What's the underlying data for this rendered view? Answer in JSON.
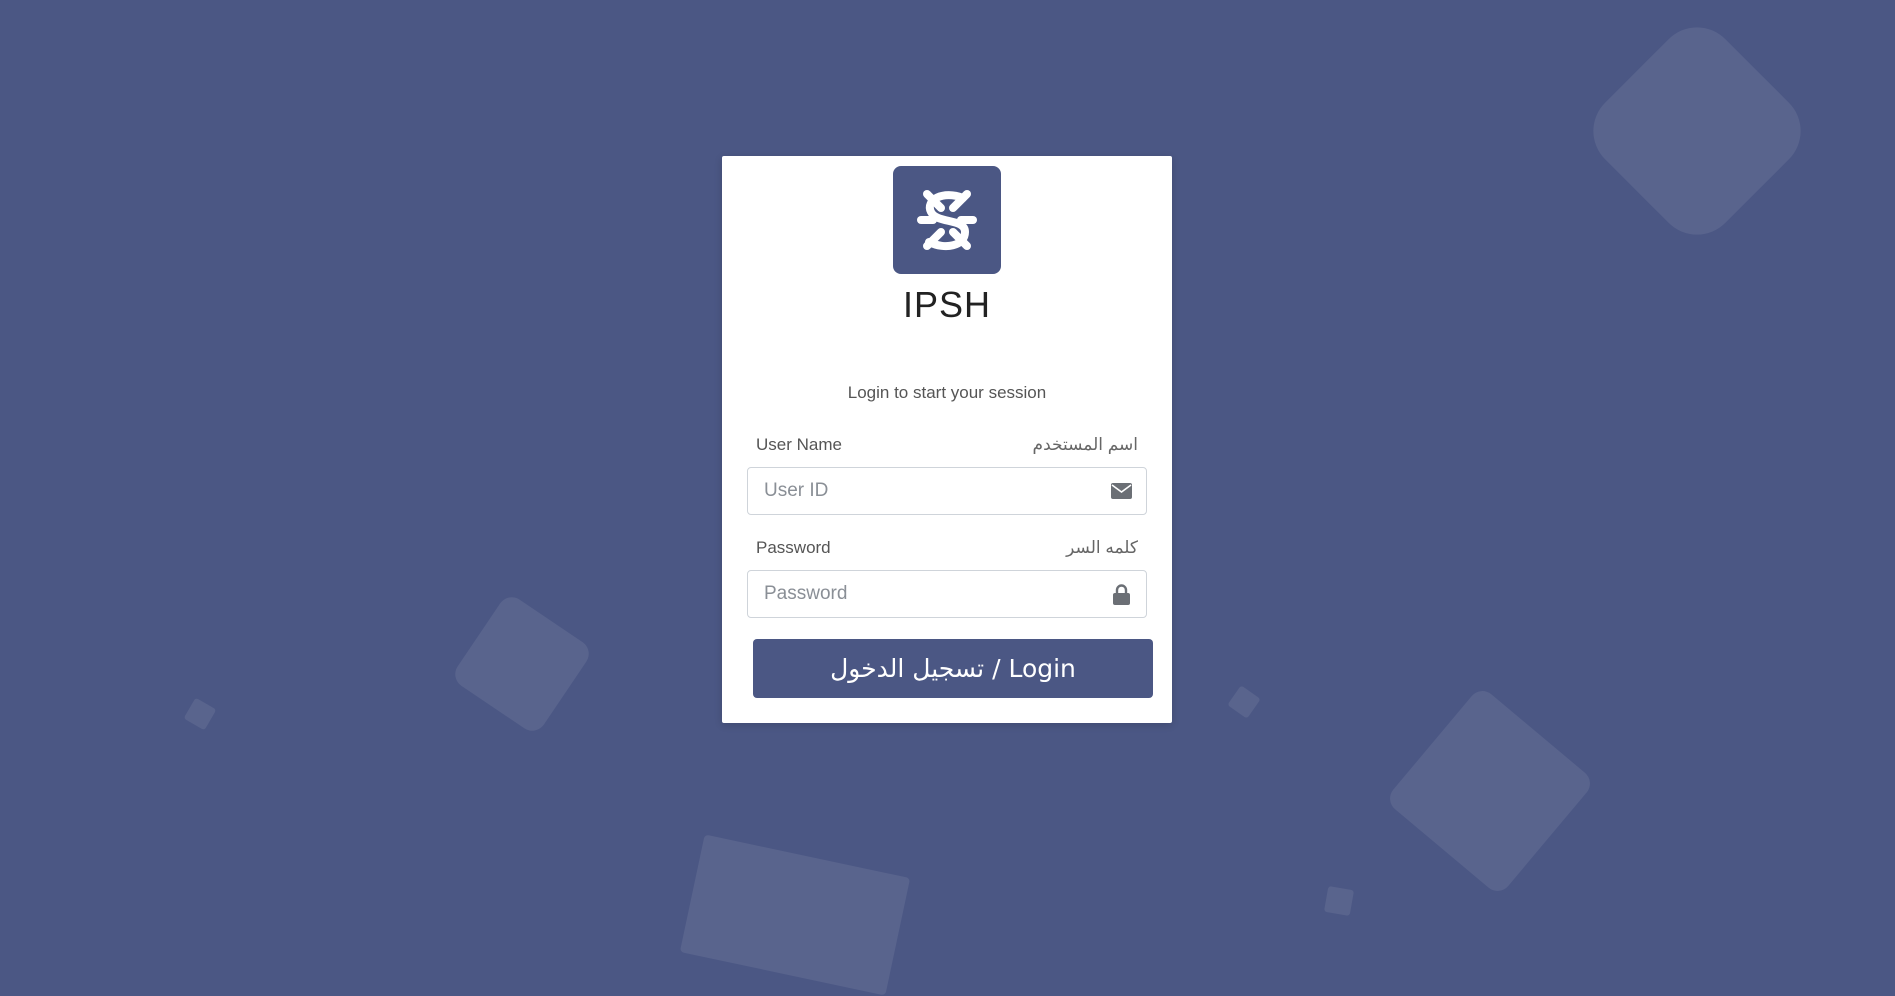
{
  "brand": {
    "name": "IPSH",
    "logo_icon": "ipsh-knot-logo-icon",
    "color": "#4b5784"
  },
  "login": {
    "subtitle": "Login to start your session",
    "username": {
      "label_en": "User Name",
      "label_ar": "اسم المستخدم",
      "placeholder": "User ID",
      "value": "",
      "icon": "envelope-icon"
    },
    "password": {
      "label_en": "Password",
      "label_ar": "كلمه السر",
      "placeholder": "Password",
      "value": "",
      "icon": "lock-icon"
    },
    "button_label": "تسجيل الدخول / Login"
  },
  "colors": {
    "background": "#4b5784",
    "card": "#ffffff",
    "button": "#4b5784"
  }
}
